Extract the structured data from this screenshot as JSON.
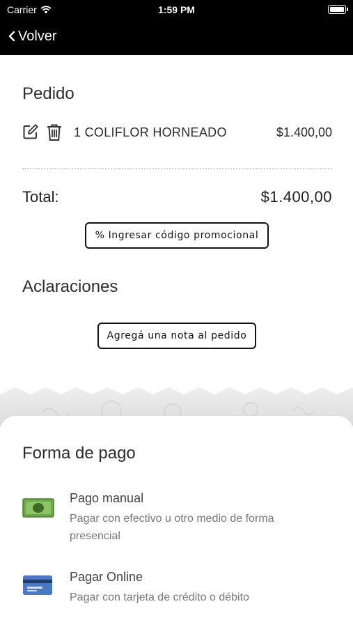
{
  "status_bar": {
    "carrier": "Carrier",
    "time": "1:59 PM"
  },
  "nav": {
    "back_label": "Volver"
  },
  "order": {
    "title": "Pedido",
    "items": [
      {
        "quantity_name": "1 COLIFLOR HORNEADO",
        "price": "$1.400,00"
      }
    ],
    "total_label": "Total:",
    "total_value": "$1.400,00",
    "promo_button": "% Ingresar código promocional"
  },
  "notes": {
    "title": "Aclaraciones",
    "add_note_button": "Agregá una nota al pedido"
  },
  "payment": {
    "title": "Forma de pago",
    "options": [
      {
        "title": "Pago manual",
        "description": "Pagar con efectivo u otro medio de forma presencial",
        "icon": "cash-icon"
      },
      {
        "title": "Pagar Online",
        "description": "Pagar con tarjeta de crédito o débito",
        "icon": "credit-card-icon"
      }
    ]
  },
  "colors": {
    "accent": "#000000",
    "cash_green": "#6fa84a",
    "card_blue": "#4a78c2"
  }
}
